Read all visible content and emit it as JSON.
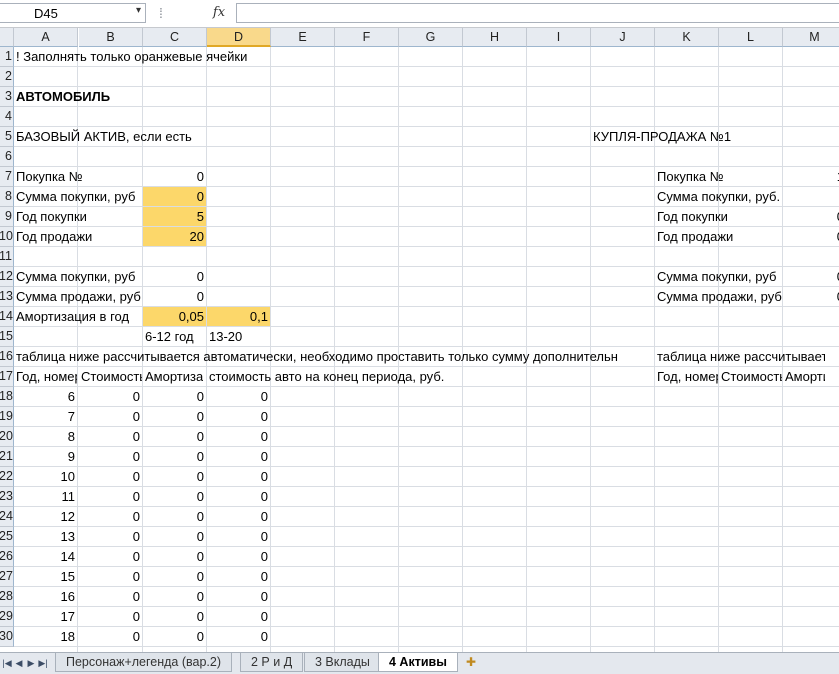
{
  "formula_bar": {
    "name_box": "D45",
    "fx_label": "fx",
    "formula": ""
  },
  "columns": [
    "A",
    "B",
    "C",
    "D",
    "E",
    "F",
    "G",
    "H",
    "I",
    "J",
    "K",
    "L",
    "M"
  ],
  "selected_column": "D",
  "rows": [
    "1",
    "2",
    "3",
    "4",
    "5",
    "6",
    "7",
    "8",
    "9",
    "10",
    "11",
    "12",
    "13",
    "14",
    "15",
    "16",
    "17",
    "18",
    "19",
    "20",
    "21",
    "22",
    "23",
    "24",
    "25",
    "26",
    "27",
    "28",
    "29",
    "30"
  ],
  "cells": {
    "A1": "! Заполнять только оранжевые ячейки",
    "A3": "АВТОМОБИЛЬ",
    "A5": "БАЗОВЫЙ АКТИВ, если есть",
    "J5": "КУПЛЯ-ПРОДАЖА №1",
    "A7": "Покупка №",
    "C7": "0",
    "A8": "Сумма покупки, руб",
    "C8": "0",
    "A9": "Год покупки",
    "C9": "5",
    "A10": "Год продажи",
    "C10": "20",
    "A12": "Сумма покупки, руб",
    "C12": "0",
    "A13": "Сумма продажи, руб",
    "C13": "0",
    "A14": "Амортизация в год",
    "C14": "0,05",
    "D14": "0,1",
    "C15": "6-12 год",
    "D15": "13-20",
    "A16": "таблица ниже рассчитывается автоматически, необходимо проставить только сумму дополнительн",
    "A17": "Год, номер",
    "B17": "Стоимость",
    "C17": "Амортиза",
    "D17": "стоимость авто на конец периода, руб.",
    "K7": "Покупка №",
    "M7": "1",
    "K8": "Сумма покупки, руб.",
    "K9": "Год покупки",
    "M9": "0",
    "K10": "Год продажи",
    "M10": "0",
    "K12": "Сумма покупки, руб",
    "M12": "0",
    "K13": "Сумма продажи, руб",
    "M13": "0",
    "K16": "таблица ниже рассчитывается",
    "K17": "Год, номер",
    "L17": "Стоимость",
    "M17": "Амортиза"
  },
  "table_rows": [
    [
      "6",
      "0",
      "0",
      "0"
    ],
    [
      "7",
      "0",
      "0",
      "0"
    ],
    [
      "8",
      "0",
      "0",
      "0"
    ],
    [
      "9",
      "0",
      "0",
      "0"
    ],
    [
      "10",
      "0",
      "0",
      "0"
    ],
    [
      "11",
      "0",
      "0",
      "0"
    ],
    [
      "12",
      "0",
      "0",
      "0"
    ],
    [
      "13",
      "0",
      "0",
      "0"
    ],
    [
      "14",
      "0",
      "0",
      "0"
    ],
    [
      "15",
      "0",
      "0",
      "0"
    ],
    [
      "16",
      "0",
      "0",
      "0"
    ],
    [
      "17",
      "0",
      "0",
      "0"
    ],
    [
      "18",
      "0",
      "0",
      "0"
    ]
  ],
  "input_cells": [
    "C8",
    "C9",
    "C10",
    "C14",
    "D14"
  ],
  "sheet_tabs": [
    {
      "label": "Персонаж+легенда (вар.2)",
      "active": false
    },
    {
      "label": "2 Р и Д",
      "active": false
    },
    {
      "label": "3 Вклады",
      "active": false
    },
    {
      "label": "4 Активы",
      "active": true
    }
  ],
  "colors": {
    "input_fill": "#fcd76a",
    "selected_header": "#f9d98b",
    "header_bg": "#e7ebf1",
    "gridline": "#d9dde3"
  },
  "icons": {
    "name_box_dropdown": "chevron-down-icon",
    "fx": "function-icon",
    "new_sheet": "insert-sheet-icon"
  }
}
